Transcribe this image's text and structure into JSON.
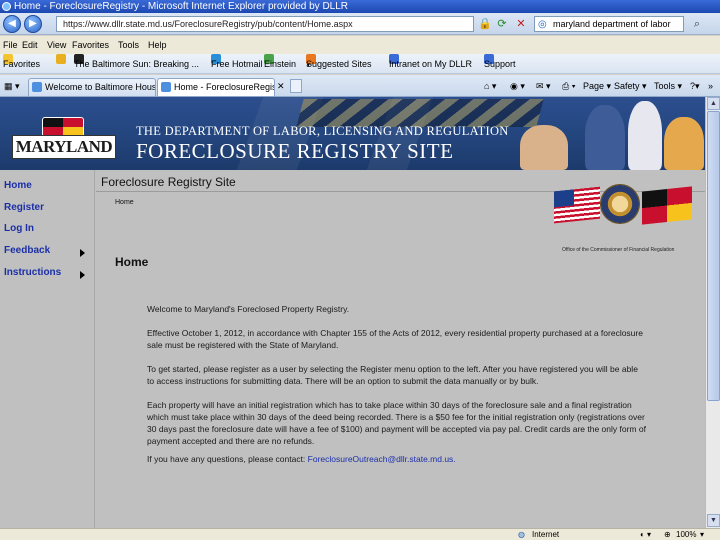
{
  "window": {
    "title": "Home - ForeclosureRegistry - Microsoft Internet Explorer provided by DLLR"
  },
  "address_bar": {
    "url": "https://www.dllr.state.md.us/ForeclosureRegistry/pub/content/Home.aspx",
    "search_value": "maryland department of labor"
  },
  "menu": {
    "items": [
      "File",
      "Edit",
      "View",
      "Favorites",
      "Tools",
      "Help"
    ]
  },
  "favorites_bar": {
    "label": "Favorites",
    "items": [
      "The Baltimore Sun: Breaking ...",
      "Free Hotmail",
      "Einstein",
      "Suggested Sites",
      "Intranet on My DLLR",
      "Support"
    ]
  },
  "tabs": [
    {
      "label": "Welcome to Baltimore Housing"
    },
    {
      "label": "Home - ForeclosureRegistry"
    }
  ],
  "command_bar": {
    "page": "Page",
    "safety": "Safety",
    "tools": "Tools"
  },
  "banner": {
    "logo_text": "MARYLAND",
    "department": "THE DEPARTMENT OF LABOR, LICENSING AND REGULATION",
    "site": "FORECLOSURE REGISTRY SITE"
  },
  "nav": {
    "items": [
      {
        "label": "Home",
        "has_submenu": false
      },
      {
        "label": "Register",
        "has_submenu": false
      },
      {
        "label": "Log In",
        "has_submenu": false
      },
      {
        "label": "Feedback",
        "has_submenu": true
      },
      {
        "label": "Instructions",
        "has_submenu": true
      }
    ]
  },
  "content": {
    "section_title": "Foreclosure Registry Site",
    "breadcrumb": "Home",
    "seal_caption": "Office of the Commissioner of Financial Regulation",
    "heading": "Home",
    "paragraphs": [
      "Welcome to Maryland's Foreclosed Property Registry.",
      "Effective October 1, 2012, in accordance with Chapter 155 of the Acts of 2012, every residential property purchased at a foreclosure sale must be registered with the State of Maryland.",
      "To get started, please register as a user by selecting the Register menu option to the left. After you have registered you will be able to access instructions for submitting data. There will be an option to submit the data manually or by bulk.",
      "Each property will have an initial registration which has to take place within 30 days of the foreclosure sale and a final registration which must take place within 30 days of the deed being recorded. There is a $50 fee for the initial registration only (registrations over 30 days past the foreclosure date will have a fee of $100) and payment will be accepted via pay pal. Credit cards are the only form of payment accepted and there are no refunds."
    ],
    "contact_prefix": "If you have any questions, please contact:",
    "contact_email": "ForeclosureOutreach@dllr.state.md.us."
  },
  "status_bar": {
    "zone": "Internet",
    "zoom": "100%"
  }
}
